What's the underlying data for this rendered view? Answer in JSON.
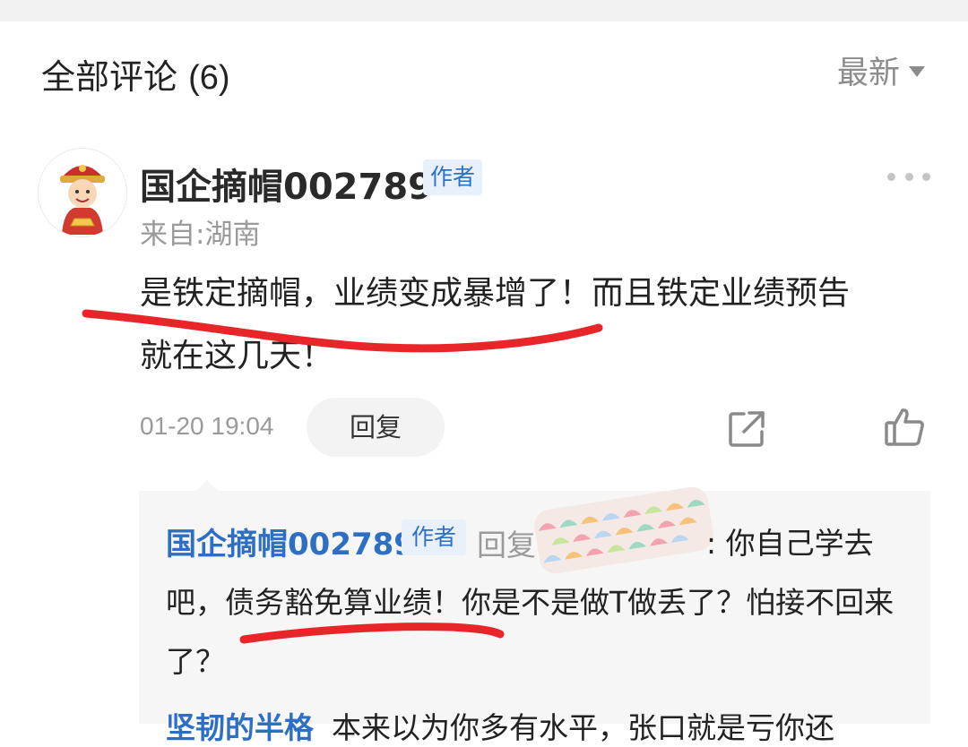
{
  "header": {
    "title": "全部评论",
    "count": "(6)",
    "sort_label": "最新"
  },
  "comment": {
    "username": "国企摘帽002789",
    "author_badge": "作者",
    "location": "来自:湖南",
    "body_line_1": "是铁定摘帽，业绩变成暴增了！而且铁定业绩预告",
    "body_line_2": "就在这几天！",
    "timestamp": "01-20 19:04",
    "reply_button": "回复"
  },
  "reply": {
    "username": "国企摘帽002789",
    "author_badge": "作者",
    "reply_verb": "回复",
    "line_1": ": 你自己学去",
    "line_2": "吧，债务豁免算业绩！你是不是做T做丢了？怕接不回来",
    "line_3": "了？",
    "next_username": "坚韧的半格",
    "next_text": "本来以为你多有水平，张口就是亏你还"
  },
  "annotation": {
    "stroke_color": "#e8262a"
  },
  "colors": {
    "accent_blue": "#2d6fc4",
    "badge_bg": "#e7f0fb",
    "muted_text": "#9a9a9a"
  }
}
